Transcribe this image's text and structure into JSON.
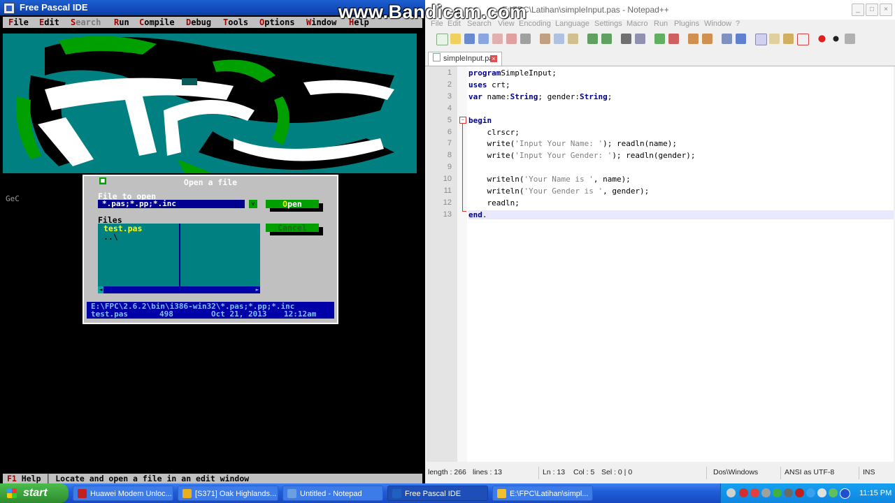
{
  "fpc": {
    "title": "Free Pascal IDE",
    "menu": [
      "File",
      "Edit",
      "Search",
      "Run",
      "Compile",
      "Debug",
      "Tools",
      "Options",
      "Window",
      "Help"
    ],
    "logo_caption": "GeC",
    "status_key": "F1",
    "status_text": "Help │ Locate and open a file in an edit window",
    "dialog": {
      "title": "Open a file",
      "file_label": "File to open",
      "file_value": "*.pas;*.pp;*.inc",
      "open_label": "Open",
      "cancel_label": "Cancel",
      "files_label": "Files",
      "files": [
        "test.pas",
        "..\\"
      ],
      "info_path": "E:\\FPC\\2.6.2\\bin\\i386-win32\\*.pas;*.pp;*.inc",
      "info_name": "test.pas",
      "info_size": "498",
      "info_date": "Oct 21, 2013",
      "info_time": "12:12am"
    }
  },
  "npp": {
    "title": "E:\\FPC\\Latihan\\simpleInput.pas - Notepad++",
    "menu": [
      "File",
      "Edit",
      "Search",
      "View",
      "Encoding",
      "Language",
      "Settings",
      "Macro",
      "Run",
      "Plugins",
      "Window",
      "?"
    ],
    "tab": "simpleInput.pas",
    "status": {
      "length": "length : 266",
      "lines": "lines : 13",
      "ln": "Ln : 13",
      "col": "Col : 5",
      "sel": "Sel : 0 | 0",
      "eol": "Dos\\Windows",
      "encoding": "ANSI as UTF-8",
      "mode": "INS"
    }
  },
  "code": [
    {
      "n": "1",
      "parts": [
        [
          "kw",
          "program"
        ],
        [
          "",
          "SimpleInput;"
        ]
      ]
    },
    {
      "n": "2",
      "parts": [
        [
          "kw",
          "uses"
        ],
        [
          "",
          " crt;"
        ]
      ]
    },
    {
      "n": "3",
      "parts": [
        [
          "kw",
          "var"
        ],
        [
          "",
          " name:"
        ],
        [
          "kw",
          "String"
        ],
        [
          "",
          "; gender:"
        ],
        [
          "kw",
          "String"
        ],
        [
          "",
          ";"
        ]
      ]
    },
    {
      "n": "4",
      "parts": []
    },
    {
      "n": "5",
      "parts": [
        [
          "kw",
          "begin"
        ]
      ]
    },
    {
      "n": "6",
      "parts": [
        [
          "",
          "    clrscr;"
        ]
      ]
    },
    {
      "n": "7",
      "parts": [
        [
          "",
          "    write("
        ],
        [
          "st",
          "'Input Your Name: '"
        ],
        [
          "",
          "); readln(name);"
        ]
      ]
    },
    {
      "n": "8",
      "parts": [
        [
          "",
          "    write("
        ],
        [
          "st",
          "'Input Your Gender: '"
        ],
        [
          "",
          "); readln(gender);"
        ]
      ]
    },
    {
      "n": "9",
      "parts": []
    },
    {
      "n": "10",
      "parts": [
        [
          "",
          "    writeln("
        ],
        [
          "st",
          "'Your Name is '"
        ],
        [
          "",
          ", name);"
        ]
      ]
    },
    {
      "n": "11",
      "parts": [
        [
          "",
          "    writeln("
        ],
        [
          "st",
          "'Your Gender is '"
        ],
        [
          "",
          ", gender);"
        ]
      ]
    },
    {
      "n": "12",
      "parts": [
        [
          "",
          "    readln;"
        ]
      ]
    },
    {
      "n": "13",
      "parts": [
        [
          "kw",
          "end"
        ],
        [
          "",
          "."
        ]
      ]
    }
  ],
  "watermark": "www.Bandicam.com",
  "taskbar": {
    "start": "start",
    "tasks": [
      {
        "label": "Huawei Modem Unloc...",
        "color": "#c02020"
      },
      {
        "label": "[S371] Oak Highlands...",
        "color": "#e8b020"
      },
      {
        "label": "Untitled - Notepad",
        "color": "#6aa0e0"
      },
      {
        "label": "Free Pascal IDE",
        "color": "#2060c0"
      },
      {
        "label": "E:\\FPC\\Latihan\\simpl...",
        "color": "#f0c030"
      }
    ],
    "clock": "11:15 PM"
  }
}
